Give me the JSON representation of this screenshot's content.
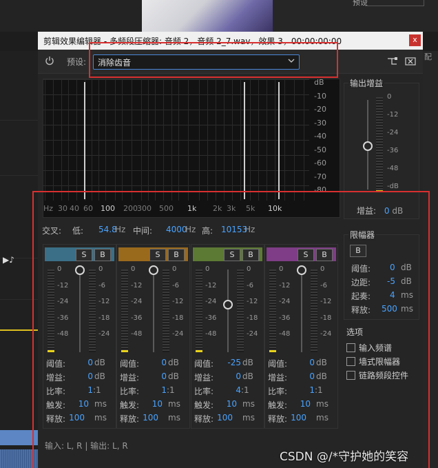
{
  "background": {
    "right_top_label": "预设",
    "right_side_text": "配",
    "tools_icons": "▶♪"
  },
  "dialog": {
    "title": "剪辑效果编辑器 - 多频段压缩器: 音频 2，音频 2_7.wav，效果 3，00:00:00:00",
    "close_label": "x",
    "preset_label": "预设:",
    "preset_value": "消除齿音",
    "icons": [
      "power-icon",
      "chevron-down-icon",
      "route-icon",
      "clear-icon"
    ]
  },
  "graph": {
    "db_ticks": [
      "dB",
      "-10",
      "-20",
      "-30",
      "-40",
      "-50",
      "-60",
      "-70",
      "-80"
    ],
    "hz_ticks": [
      {
        "label": "Hz",
        "major": false
      },
      {
        "label": "30",
        "major": false
      },
      {
        "label": "40",
        "major": false
      },
      {
        "label": "60",
        "major": false
      },
      {
        "label": "100",
        "major": true
      },
      {
        "label": "200",
        "major": false
      },
      {
        "label": "300",
        "major": false
      },
      {
        "label": "500",
        "major": false
      },
      {
        "label": "1k",
        "major": true
      },
      {
        "label": "2k",
        "major": false
      },
      {
        "label": "3k",
        "major": false
      },
      {
        "label": "5k",
        "major": false
      },
      {
        "label": "10k",
        "major": true
      }
    ]
  },
  "output_gain": {
    "title": "输出增益",
    "ticks": [
      "0",
      "-12",
      "-24",
      "-36",
      "-48",
      "-dB"
    ],
    "gain_label": "增益:",
    "gain_value": "0",
    "gain_unit": "dB"
  },
  "crossover": {
    "label": "交叉:",
    "low_label": "低:",
    "low_value": "54.8",
    "mid_label": "中间:",
    "mid_value": "4000",
    "high_label": "高:",
    "high_value": "10153",
    "unit": "Hz"
  },
  "band_labels": {
    "solo": "S",
    "bypass": "B",
    "threshold": "阈值:",
    "gain": "增益:",
    "ratio": "比率:",
    "attack": "触发:",
    "release": "释放:",
    "db": "dB",
    "ms": "ms",
    "ratio_suffix": ":1"
  },
  "bands": [
    {
      "color": "#3b6f87",
      "threshold": "0",
      "gain": "0",
      "ratio": "1",
      "attack": "10",
      "release": "100",
      "left_ticks": [
        "0",
        "-12",
        "-24",
        "-36",
        "-48"
      ],
      "right_ticks": [
        "0",
        "-6",
        "-12",
        "-18",
        "-24"
      ],
      "knob_level": 1.0
    },
    {
      "color": "#9a6a1c",
      "threshold": "0",
      "gain": "0",
      "ratio": "1",
      "attack": "10",
      "release": "100",
      "left_ticks": [
        "0",
        "-12",
        "-24",
        "-36",
        "-48"
      ],
      "right_ticks": [
        "0",
        "-6",
        "-12",
        "-18",
        "-24"
      ],
      "knob_level": 1.0
    },
    {
      "color": "#5d7a34",
      "threshold": "-25",
      "gain": "0",
      "ratio": "4",
      "attack": "10",
      "release": "100",
      "left_ticks": [
        "0",
        "-12",
        "-24",
        "-36",
        "-48"
      ],
      "right_ticks": [
        "0",
        "-6",
        "-12",
        "-18",
        "-24"
      ],
      "knob_level": 0.55
    },
    {
      "color": "#7e3d86",
      "threshold": "0",
      "gain": "0",
      "ratio": "1",
      "attack": "10",
      "release": "100",
      "left_ticks": [
        "0",
        "-12",
        "-24",
        "-36",
        "-48"
      ],
      "right_ticks": [
        "0",
        "-6",
        "-12",
        "-18",
        "-24"
      ],
      "knob_level": 1.0
    }
  ],
  "limiter": {
    "title": "限幅器",
    "bypass": "B",
    "threshold_label": "阈值:",
    "threshold_value": "0",
    "threshold_unit": "dB",
    "margin_label": "边距:",
    "margin_value": "-5",
    "margin_unit": "dB",
    "attack_label": "起奏:",
    "attack_value": "4",
    "attack_unit": "ms",
    "release_label": "释放:",
    "release_value": "500",
    "release_unit": "ms"
  },
  "options": {
    "title": "选项",
    "items": [
      "输入频谱",
      "墙式限幅器",
      "链路频段控件"
    ]
  },
  "io_label": "输入: L, R | 输出: L, R",
  "watermark": "CSDN @/*守护她的笑容"
}
